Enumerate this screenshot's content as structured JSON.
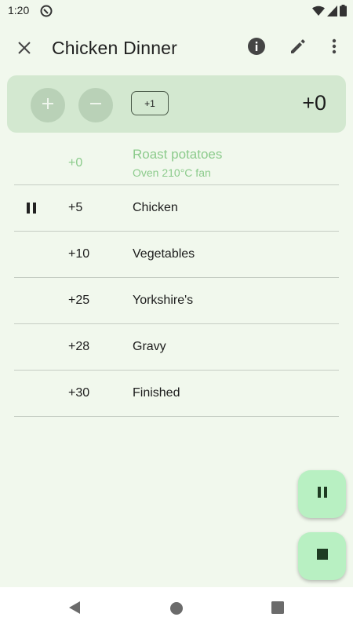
{
  "status_bar": {
    "time": "1:20"
  },
  "app_bar": {
    "title": "Chicken Dinner"
  },
  "controls": {
    "step_label": "+1",
    "offset_value": "+0"
  },
  "steps": [
    {
      "time": "+0",
      "name": "Roast potatoes",
      "note": "Oven 210°C fan",
      "state": "done"
    },
    {
      "time": "+5",
      "name": "Chicken",
      "state": "paused"
    },
    {
      "time": "+10",
      "name": "Vegetables",
      "state": "pending"
    },
    {
      "time": "+25",
      "name": "Yorkshire's",
      "state": "pending"
    },
    {
      "time": "+28",
      "name": "Gravy",
      "state": "pending"
    },
    {
      "time": "+30",
      "name": "Finished",
      "state": "pending"
    }
  ],
  "colors": {
    "background": "#f1f8ed",
    "card": "#d3e8d0",
    "done_text": "#8ccb8c",
    "fab": "#b8f0c2"
  },
  "icons": {
    "close": "close-icon",
    "info": "info-icon",
    "edit": "pencil-icon",
    "more": "more-vert-icon",
    "plus": "plus-icon",
    "minus": "minus-icon",
    "pause": "pause-icon",
    "stop": "stop-icon"
  }
}
